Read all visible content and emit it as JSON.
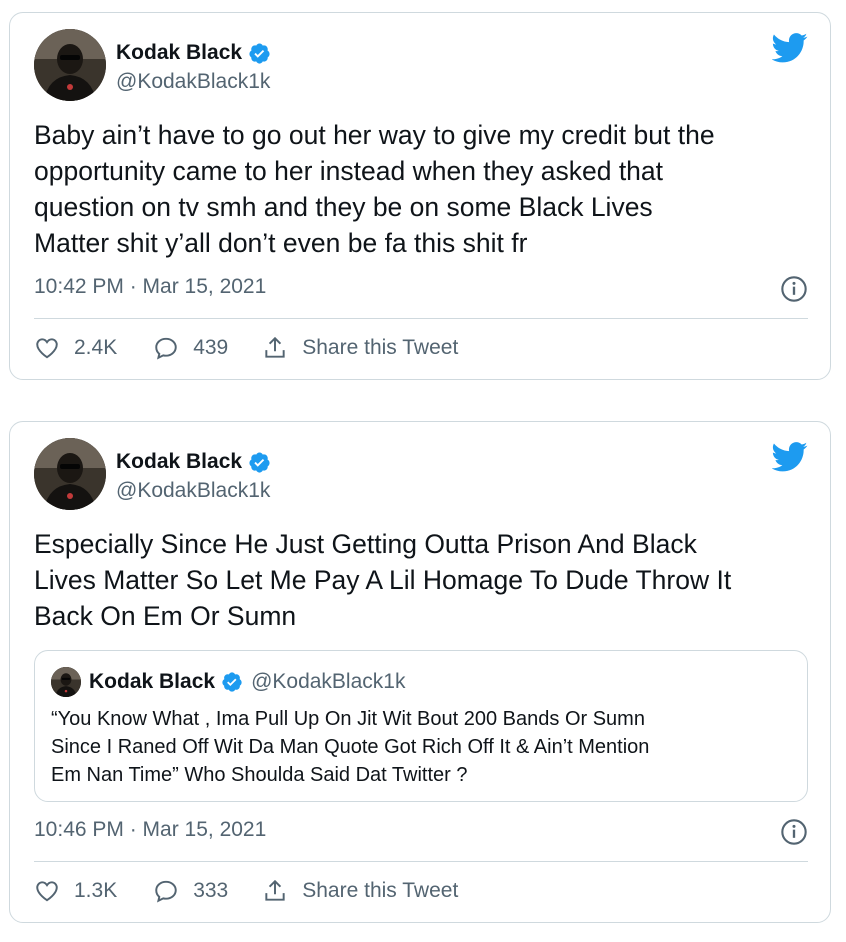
{
  "tweets": [
    {
      "author_name": "Kodak Black",
      "handle": "@KodakBlack1k",
      "text": "Baby ain’t have to go out her way to give my credit but the\nopportunity came to her instead when they asked that\nquestion on tv smh and they be on some Black Lives\nMatter shit y’all don’t even be fa this shit fr",
      "timestamp": "10:42 PM · Mar 15, 2021",
      "likes": "2.4K",
      "replies": "439",
      "share_label": "Share this Tweet"
    },
    {
      "author_name": "Kodak Black",
      "handle": "@KodakBlack1k",
      "text": "Especially Since He Just Getting Outta Prison And Black\nLives Matter So Let Me Pay A Lil Homage To Dude Throw It\nBack On Em Or Sumn",
      "quoted": {
        "author_name": "Kodak Black",
        "handle": "@KodakBlack1k",
        "text": "“You Know What , Ima Pull Up On Jit Wit Bout 200 Bands Or Sumn\nSince I Raned Off Wit Da Man Quote Got Rich Off It & Ain’t Mention\nEm Nan Time” Who Shoulda Said Dat Twitter ?"
      },
      "timestamp": "10:46 PM · Mar 15, 2021",
      "likes": "1.3K",
      "replies": "333",
      "share_label": "Share this Tweet"
    }
  ],
  "colors": {
    "twitter_blue": "#1d9bf0",
    "muted_text": "#536471",
    "border": "#cfd9de"
  },
  "icons": [
    "twitter-bird-icon",
    "verified-badge-icon",
    "info-icon",
    "heart-icon",
    "reply-bubble-icon",
    "share-icon"
  ]
}
